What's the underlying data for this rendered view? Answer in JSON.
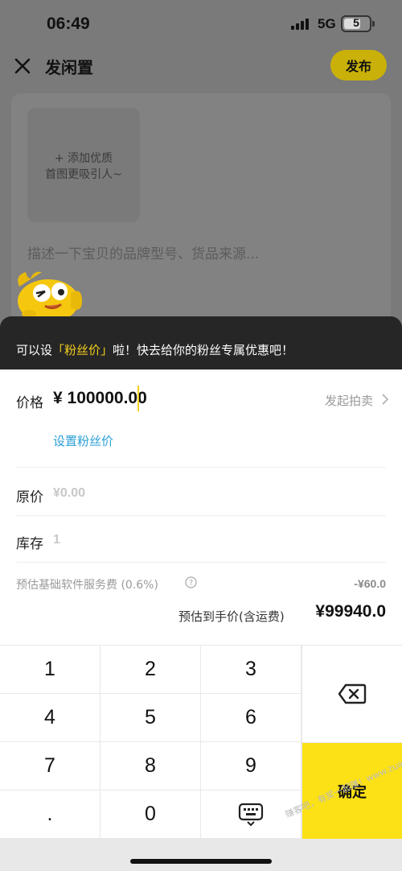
{
  "status_bar": {
    "time": "06:49",
    "network": "5G",
    "battery_level": "5"
  },
  "header": {
    "title": "发闲置",
    "publish_label": "发布"
  },
  "editor": {
    "add_photo_line1": "+ 添加优质",
    "add_photo_line2": "首图更吸引人~",
    "description_placeholder": "描述一下宝贝的品牌型号、货品来源..."
  },
  "tip": {
    "prefix": "可以设",
    "highlight": "「粉丝价」",
    "suffix": "啦！快去给你的粉丝专属优惠吧！"
  },
  "price_sheet": {
    "price_label": "价格",
    "price_value": "¥ 100000.00",
    "auction_link": "发起拍卖",
    "fan_price_link": "设置粉丝价",
    "original_price_label": "原价",
    "original_price_value": "¥0.00",
    "stock_label": "库存",
    "stock_value": "1",
    "fee_label": "预估基础软件服务费 (0.6%)",
    "fee_value": "-¥60.0",
    "net_label": "预估到手价(含运费)",
    "net_value": "¥99940.0"
  },
  "keypad": {
    "keys": [
      "1",
      "2",
      "3",
      "4",
      "5",
      "6",
      "7",
      "8",
      "9",
      ".",
      "0"
    ],
    "confirm_label": "确定"
  },
  "watermark": "赚客吧，有奖一起赚！www.zuanke8.com",
  "colors": {
    "accent_yellow": "#fbe115",
    "link_blue": "#2b9fd6",
    "tip_bg": "#262626"
  }
}
